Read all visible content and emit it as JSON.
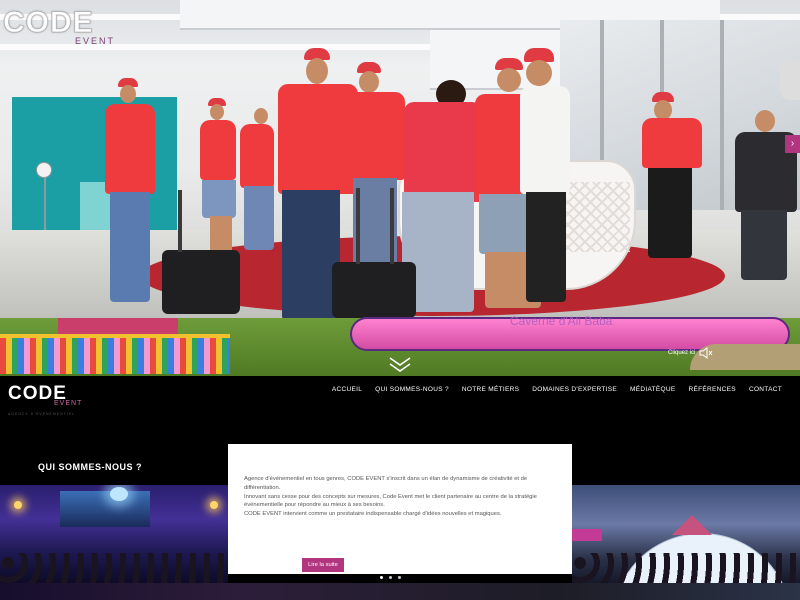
{
  "hero": {
    "logo_code": "CODE",
    "logo_event": "EVENT",
    "inflatable_text": "Caverne d'Ali Baba",
    "mute_label": "Cliquez ici",
    "mute_icon": "speaker-mute-icon",
    "scroll_icon": "chevron-down-icon",
    "next_icon": "arrow-right-icon",
    "next_symbol": "›"
  },
  "nav": {
    "logo_code": "CODE",
    "logo_event": "EVENT",
    "logo_tagline": "AGENCE D'ÉVÉNEMENTIEL",
    "items": [
      {
        "label": "ACCUEIL"
      },
      {
        "label": "QUI SOMMES-NOUS ?"
      },
      {
        "label": "NOTRE MÉTIERS"
      },
      {
        "label": "DOMAINES D'EXPERTISE"
      },
      {
        "label": "MÉDIATÈQUE"
      },
      {
        "label": "RÉFÉRENCES"
      },
      {
        "label": "CONTACT"
      }
    ]
  },
  "about": {
    "heading": "QUI SOMMES-NOUS ?",
    "paragraphs": [
      "Agence d'événementiel en tous genres, CODE EVENT s'inscrit dans un élan de dynamisme de créativité et de différentiation.",
      "Innovant sans cesse pour des concepts sur mesures, Code Event met le client partenaire au centre de la stratégie événementielle pour répondre au mieux à ses besoins.",
      "CODE EVENT intervient comme un prestataire indispensable chargé d'idées nouvelles et magiques."
    ],
    "read_more": "Lire la suite"
  },
  "colors": {
    "accent": "#b23580",
    "nav_background": "#000000",
    "card_background": "#ffffff"
  }
}
